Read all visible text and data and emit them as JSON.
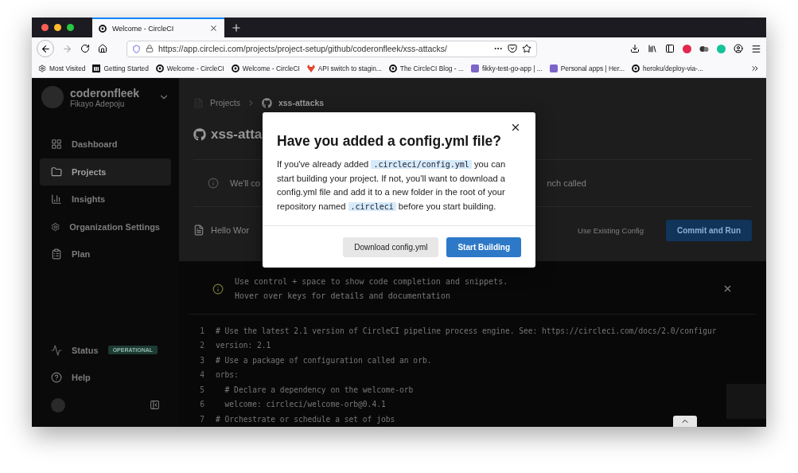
{
  "browser": {
    "tabs": [
      {
        "title": "Welcome - CircleCI",
        "selected": true
      }
    ],
    "url": "https://app.circleci.com/projects/project-setup/github/coderonfleek/xss-attacks/",
    "bookmarks": [
      {
        "label": "Most Visited",
        "kind": "gear"
      },
      {
        "label": "Getting Started",
        "kind": "m"
      },
      {
        "label": "Welcome - CircleCI",
        "kind": "circle"
      },
      {
        "label": "Welcome - CircleCI",
        "kind": "circle"
      },
      {
        "label": "API switch to stagin...",
        "kind": "fox"
      },
      {
        "label": "The CircleCI Blog - ...",
        "kind": "circle"
      },
      {
        "label": "fikky-test-go-app | ...",
        "kind": "heroku"
      },
      {
        "label": "Personal apps | Her...",
        "kind": "heroku"
      },
      {
        "label": "heroku/deploy-via-...",
        "kind": "circle"
      }
    ]
  },
  "sidebar": {
    "org": "coderonfleek",
    "user": "Fikayo Adepoju",
    "items": [
      {
        "label": "Dashboard",
        "selected": false
      },
      {
        "label": "Projects",
        "selected": true
      },
      {
        "label": "Insights",
        "selected": false
      },
      {
        "label": "Organization Settings",
        "selected": false
      },
      {
        "label": "Plan",
        "selected": false
      }
    ],
    "status": {
      "label": "Status",
      "badge": "OPERATIONAL"
    },
    "help": "Help"
  },
  "main": {
    "breadcrumb": [
      "Projects",
      "xss-attacks"
    ],
    "title": "xss-atta",
    "info": {
      "left": "We'll co",
      "right": "nch called"
    },
    "file": "Hello Wor",
    "secondary_action": "Use Existing Config",
    "primary_action": "Commit and Run",
    "editor_hint": [
      "Use control + space to show code completion and snippets.",
      "Hover over keys for details and documentation"
    ],
    "code": [
      {
        "number": "1",
        "text": "# Use the latest 2.1 version of CircleCI pipeline process engine. See: https://circleci.com/docs/2.0/configur"
      },
      {
        "number": "2",
        "text": "version: 2.1"
      },
      {
        "number": "3",
        "text": "# Use a package of configuration called an orb."
      },
      {
        "number": "4",
        "text": "orbs:"
      },
      {
        "number": "5",
        "text": "  # Declare a dependency on the welcome-orb"
      },
      {
        "number": "6",
        "text": "  welcome: circleci/welcome-orb@0.4.1"
      },
      {
        "number": "7",
        "text": "# Orchestrate or schedule a set of jobs"
      }
    ]
  },
  "modal": {
    "title": "Have you added a config.yml file?",
    "body": [
      {
        "kind": "text",
        "text": "If you've already added "
      },
      {
        "kind": "code",
        "text": ".circleci/config.yml"
      },
      {
        "kind": "text",
        "text": " you can start building your project. If not, you'll want to download a config.yml file and add it to a new folder in the root of your repository named "
      },
      {
        "kind": "code",
        "text": ".circleci"
      },
      {
        "kind": "text",
        "text": " before you start building."
      }
    ],
    "buttons": [
      {
        "label": "Download config.yml",
        "kind": "secondary"
      },
      {
        "label": "Start Building",
        "kind": "primary"
      }
    ]
  }
}
